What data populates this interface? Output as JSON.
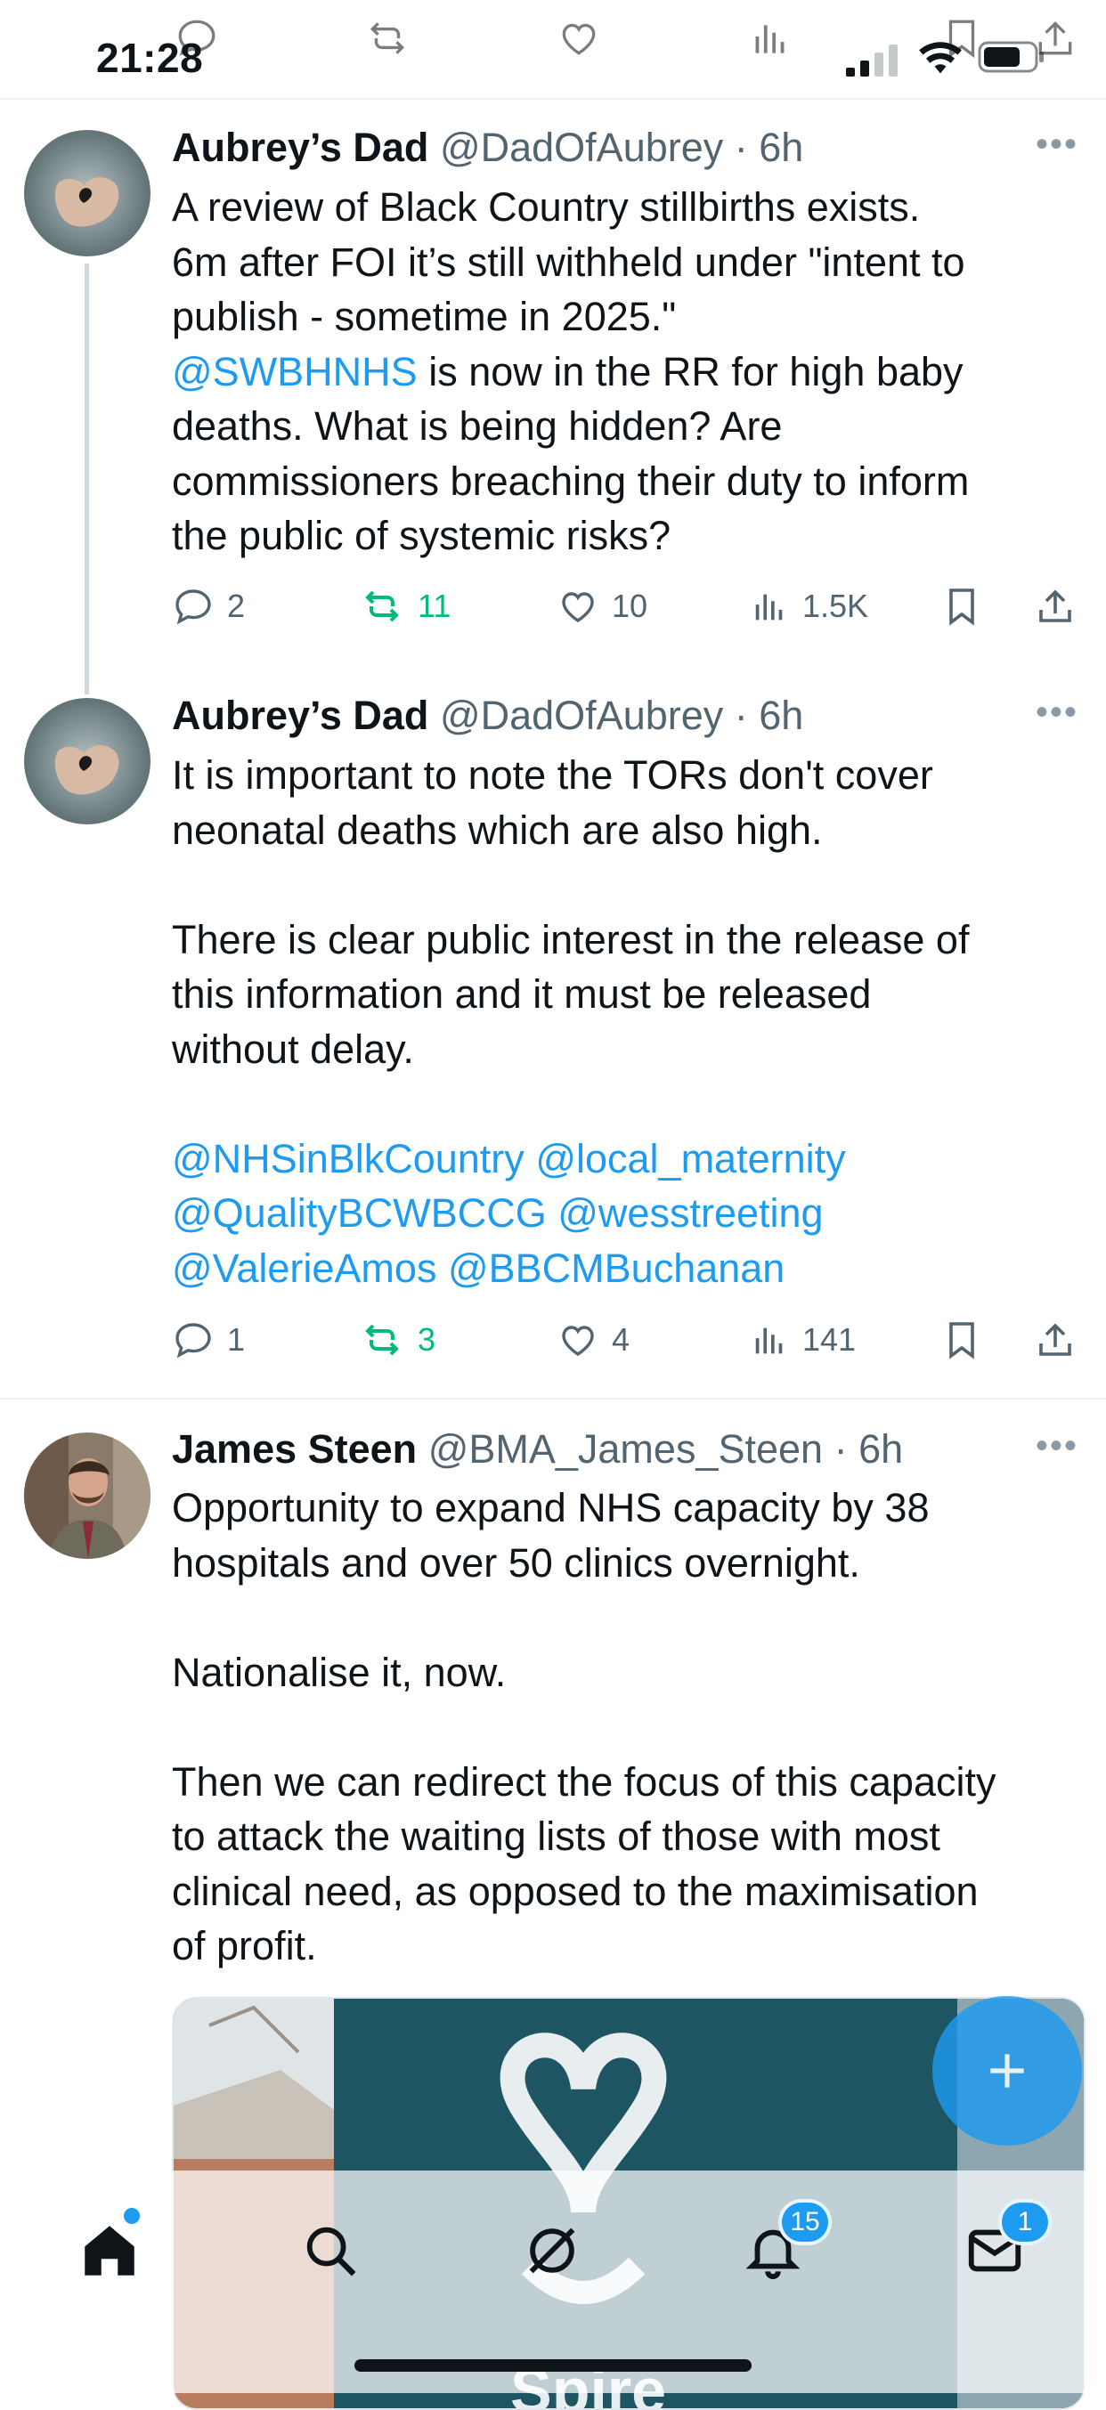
{
  "status_bar": {
    "time": "21:28"
  },
  "posts": [
    {
      "display_name": "Aubrey’s Dad",
      "handle": "@DadOfAubrey",
      "age": "6h",
      "body": [
        [
          {
            "t": "A review of Black Country stillbirths exists."
          }
        ],
        [
          {
            "t": "6m after FOI it’s still withheld under \"intent to"
          }
        ],
        [
          {
            "t": "publish - sometime in 2025.\""
          }
        ],
        [
          {
            "t": "@SWBHNHS",
            "m": true
          },
          {
            "t": " is now in the RR for high baby"
          }
        ],
        [
          {
            "t": "deaths. What is being hidden? Are"
          }
        ],
        [
          {
            "t": "commissioners breaching their duty to inform"
          }
        ],
        [
          {
            "t": "the public of systemic risks?"
          }
        ]
      ],
      "replies": "2",
      "reposts": "11",
      "likes": "10",
      "views": "1.5K"
    },
    {
      "display_name": "Aubrey’s Dad",
      "handle": "@DadOfAubrey",
      "age": "6h",
      "body": [
        [
          {
            "t": "It is important to note the TORs don't cover"
          }
        ],
        [
          {
            "t": "neonatal deaths which are also high."
          }
        ],
        [],
        [
          {
            "t": "There is clear public interest in the release of"
          }
        ],
        [
          {
            "t": "this information and it must be released"
          }
        ],
        [
          {
            "t": "without delay."
          }
        ],
        [],
        [
          {
            "t": "@NHSinBlkCountry",
            "m": true
          },
          {
            "t": " "
          },
          {
            "t": "@local_maternity",
            "m": true
          }
        ],
        [
          {
            "t": "@QualityBCWBCCG",
            "m": true
          },
          {
            "t": " "
          },
          {
            "t": "@wesstreeting",
            "m": true
          }
        ],
        [
          {
            "t": "@ValerieAmos",
            "m": true
          },
          {
            "t": " "
          },
          {
            "t": "@BBCMBuchanan",
            "m": true
          }
        ]
      ],
      "replies": "1",
      "reposts": "3",
      "likes": "4",
      "views": "141"
    },
    {
      "display_name": "James Steen",
      "handle": "@BMA_James_Steen",
      "age": "6h",
      "body": [
        [
          {
            "t": "Opportunity to expand NHS capacity by 38"
          }
        ],
        [
          {
            "t": "hospitals and over 50 clinics overnight."
          }
        ],
        [],
        [
          {
            "t": "Nationalise it, now."
          }
        ],
        [],
        [
          {
            "t": "Then we can redirect the focus of this capacity"
          }
        ],
        [
          {
            "t": "to attack the waiting lists of those with most"
          }
        ],
        [
          {
            "t": "clinical need, as opposed to the maximisation"
          }
        ],
        [
          {
            "t": "of profit."
          }
        ]
      ],
      "media_caption": "Spire"
    }
  ],
  "tab_bar": {
    "notifications_badge": "15",
    "messages_badge": "1"
  },
  "colors": {
    "accent": "#1d9bf0",
    "repost_green": "#00ba7c",
    "secondary_text": "#536471"
  }
}
